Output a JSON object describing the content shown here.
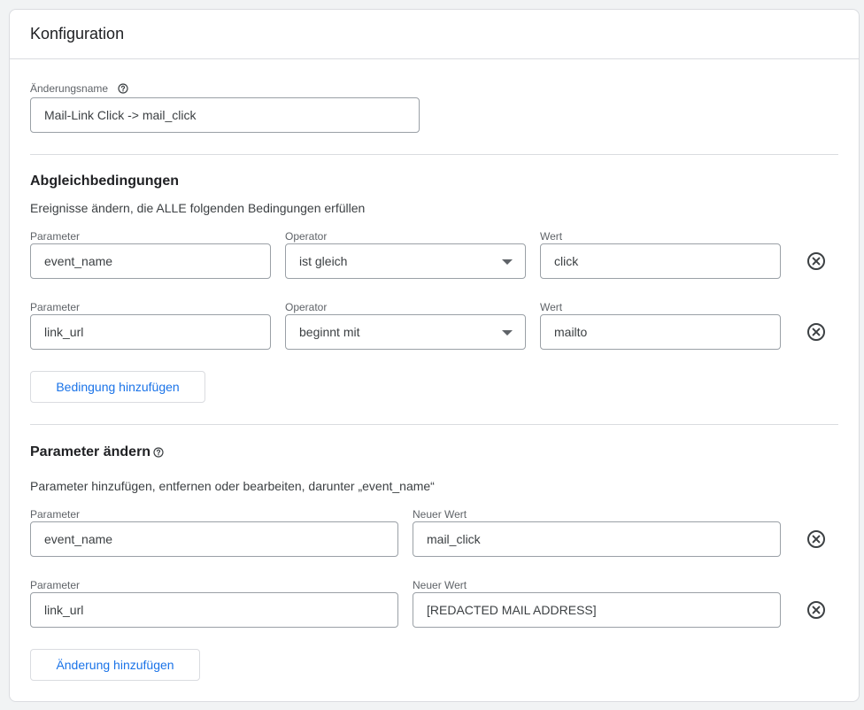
{
  "card": {
    "title": "Konfiguration"
  },
  "change_name": {
    "label": "Änderungsname",
    "value": "Mail-Link Click -> mail_click"
  },
  "match_conditions": {
    "title": "Abgleichbedingungen",
    "description": "Ereignisse ändern, die ALLE folgenden Bedingungen erfüllen",
    "rows": [
      {
        "parameter_label": "Parameter",
        "parameter_value": "event_name",
        "operator_label": "Operator",
        "operator_value": "ist gleich",
        "value_label": "Wert",
        "value_value": "click"
      },
      {
        "parameter_label": "Parameter",
        "parameter_value": "link_url",
        "operator_label": "Operator",
        "operator_value": "beginnt mit",
        "value_label": "Wert",
        "value_value": "mailto"
      }
    ],
    "add_button": "Bedingung hinzufügen"
  },
  "modify_parameters": {
    "title": "Parameter ändern",
    "description": "Parameter hinzufügen, entfernen oder bearbeiten, darunter „event_name“",
    "rows": [
      {
        "parameter_label": "Parameter",
        "parameter_value": "event_name",
        "new_value_label": "Neuer Wert",
        "new_value_value": "mail_click"
      },
      {
        "parameter_label": "Parameter",
        "parameter_value": "link_url",
        "new_value_label": "Neuer Wert",
        "new_value_value": "[REDACTED MAIL ADDRESS]"
      }
    ],
    "add_button": "Änderung hinzufügen"
  },
  "icons": {
    "help": "help-circle-icon",
    "remove": "remove-circle-icon",
    "dropdown": "caret-down-icon"
  },
  "colors": {
    "accent": "#1a73e8",
    "border": "#dadce0",
    "field_border": "#9aa0a6",
    "icon": "#3c4043"
  }
}
